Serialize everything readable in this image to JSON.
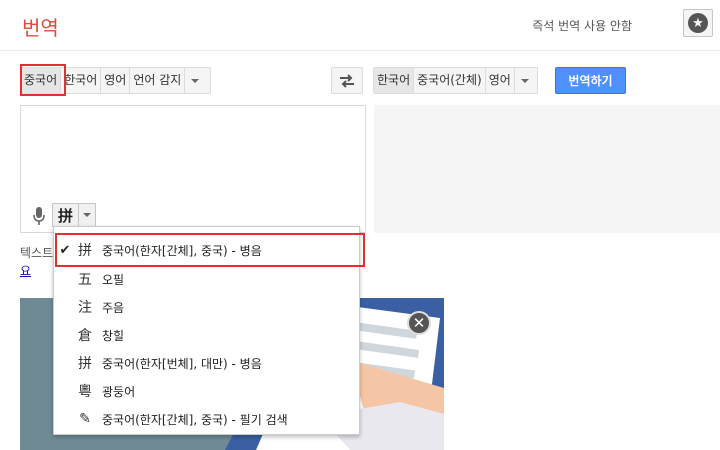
{
  "header": {
    "title": "번역",
    "instant_off": "즉석 번역 사용 안함",
    "star_icon": "star-icon"
  },
  "source_langs": {
    "items": [
      "중국어",
      "한국어",
      "영어",
      "언어 감지"
    ],
    "selected": "중국어"
  },
  "target_langs": {
    "items": [
      "한국어",
      "중국어(간체)",
      "영어"
    ],
    "selected": "한국어"
  },
  "translate_button": "번역하기",
  "ime": {
    "glyph": "拼"
  },
  "helper": {
    "text": "텍스트",
    "link": "요"
  },
  "ime_menu": {
    "items": [
      {
        "glyph": "拼",
        "label": "중국어(한자[간체], 중국) - 병음",
        "checked": true
      },
      {
        "glyph": "五",
        "label": "오필",
        "checked": false
      },
      {
        "glyph": "注",
        "label": "주음",
        "checked": false
      },
      {
        "glyph": "倉",
        "label": "창힐",
        "checked": false
      },
      {
        "glyph": "拼",
        "label": "중국어(한자[번체], 대만) - 병음",
        "checked": false
      },
      {
        "glyph": "粵",
        "label": "광둥어",
        "checked": false
      },
      {
        "glyph": "✎",
        "label": "중국어(한자[간체], 중국) - 필기 검색",
        "checked": false
      }
    ]
  },
  "colors": {
    "accent_red": "#dd4b39",
    "primary_blue": "#4d90fe",
    "highlight": "#e03030"
  }
}
